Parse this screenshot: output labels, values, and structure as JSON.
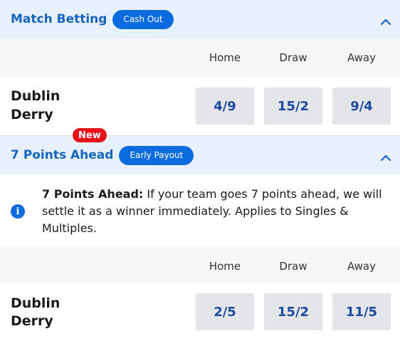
{
  "sections": [
    {
      "title": "Match Betting",
      "pill": "Cash Out",
      "columns": [
        "Home",
        "Draw",
        "Away"
      ],
      "match": {
        "team1": "Dublin",
        "team2": "Derry",
        "odds": [
          "4/9",
          "15/2",
          "9/4"
        ]
      }
    },
    {
      "title": "7 Points Ahead",
      "badge": "New",
      "pill": "Early Payout",
      "info": {
        "bold": "7 Points Ahead:",
        "text": " If your team goes 7 points ahead, we will settle it as a winner immediately. Applies to Singles & Multiples."
      },
      "columns": [
        "Home",
        "Draw",
        "Away"
      ],
      "match": {
        "team1": "Dublin",
        "team2": "Derry",
        "odds": [
          "2/5",
          "15/2",
          "11/5"
        ]
      }
    }
  ],
  "colors": {
    "accent": "#0d6be0",
    "header_bg": "#e6f1fb",
    "title": "#1565c0",
    "odds_text": "#1c4aa0",
    "odds_bg": "#e3e5e8",
    "badge": "#e8111a"
  },
  "icons": {
    "collapse": "chevron-up-icon",
    "info": "info-icon"
  }
}
